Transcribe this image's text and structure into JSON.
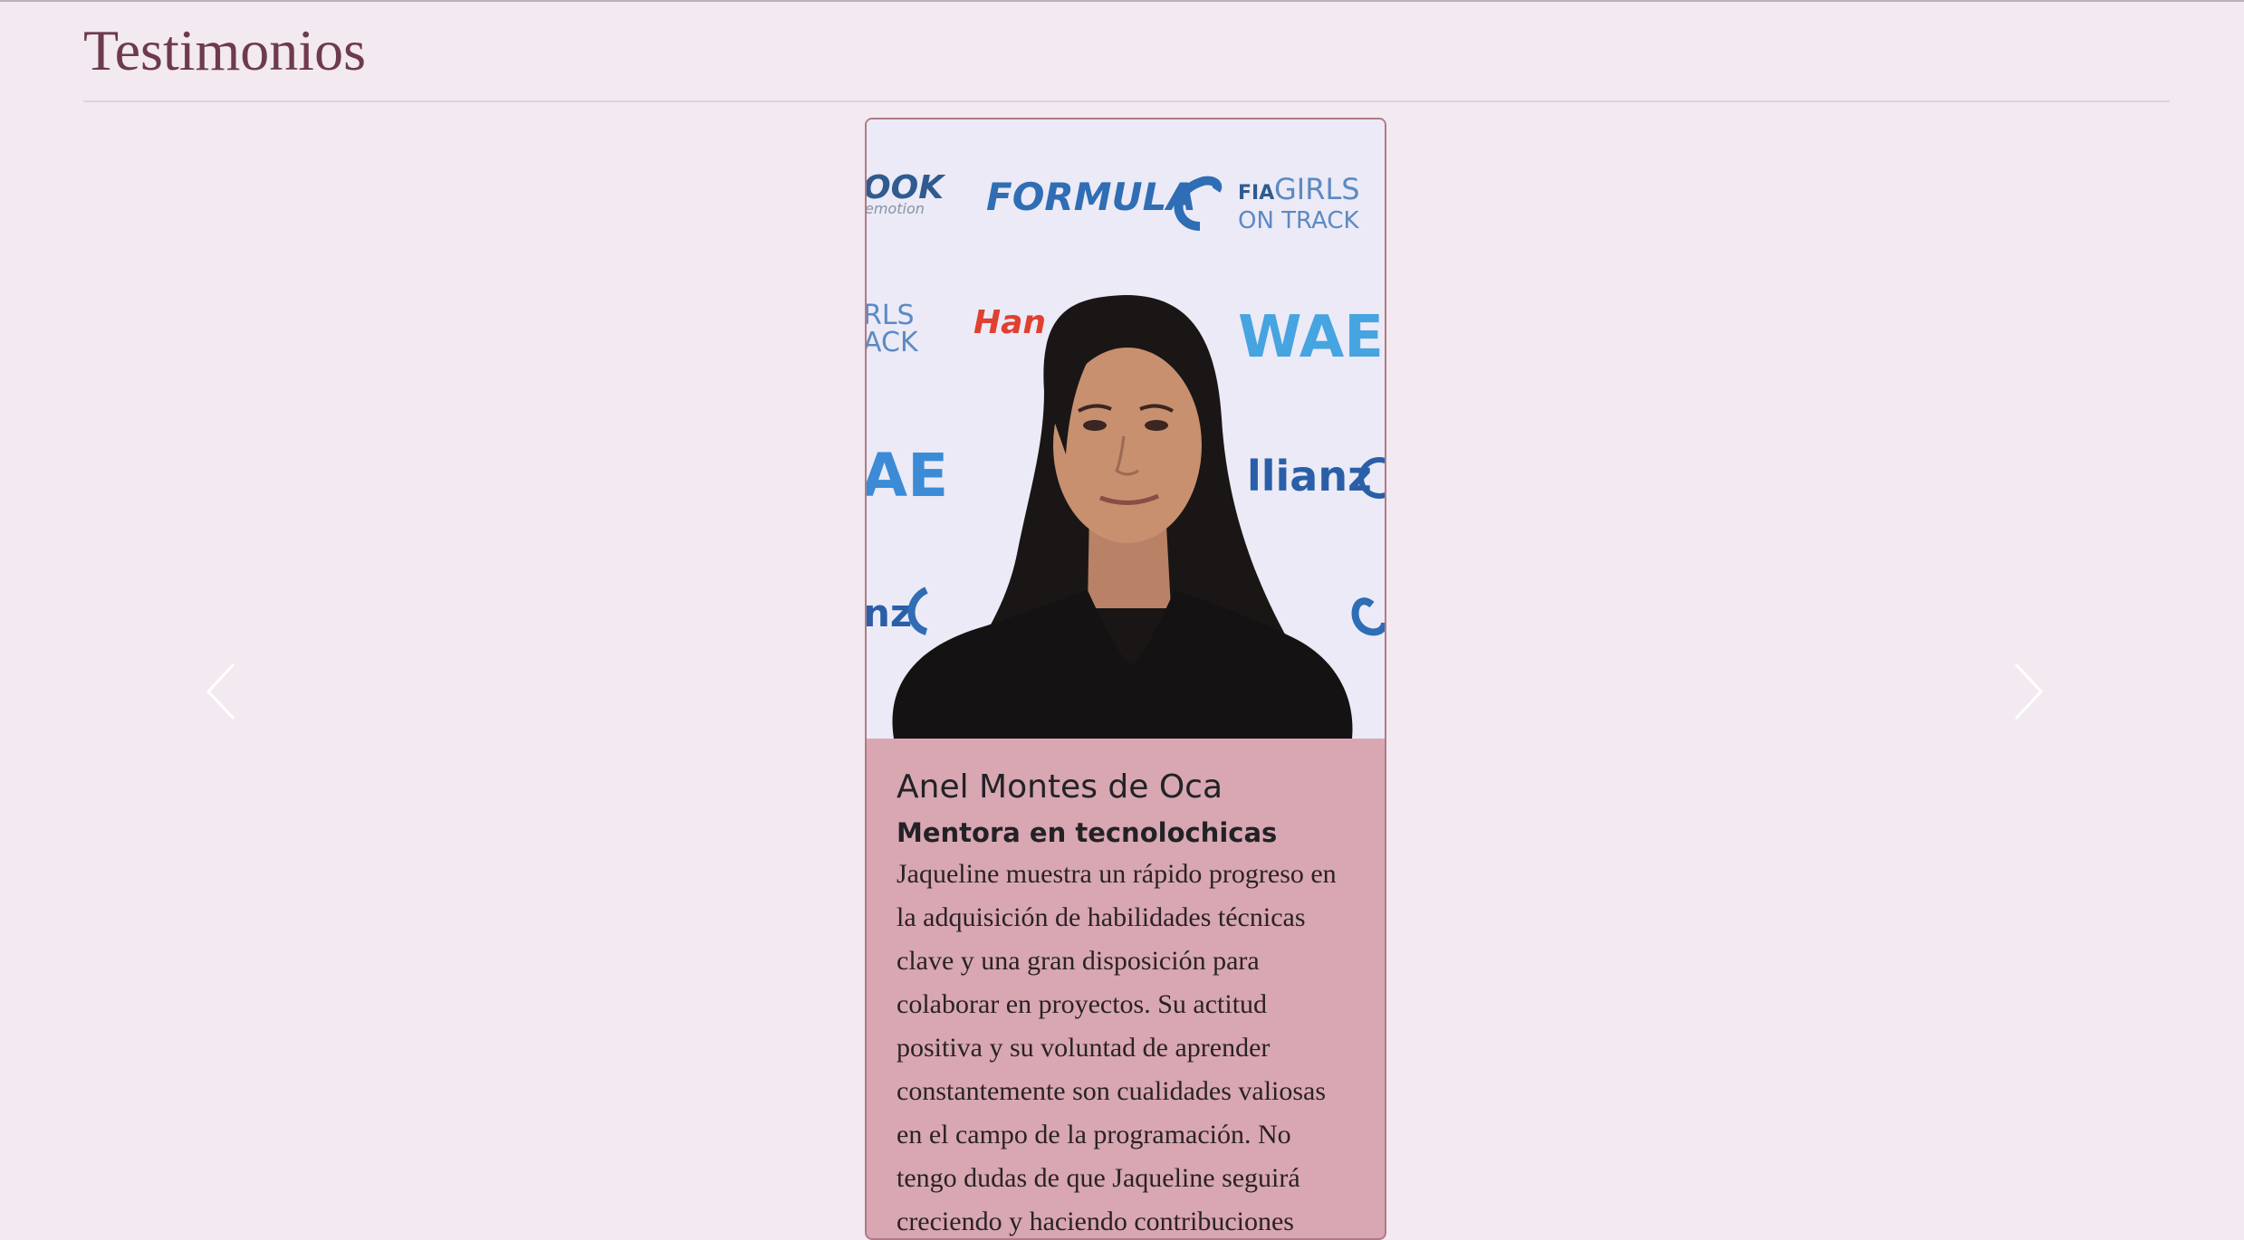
{
  "section": {
    "title": "Testimonios"
  },
  "carousel": {
    "prev_icon": "chevron-left-icon",
    "next_icon": "chevron-right-icon"
  },
  "testimonial": {
    "name": "Anel Montes de Oca",
    "role": "Mentora en tecnolochicas",
    "quote": "Jaqueline muestra un rápido progreso en la adquisición de habilidades técnicas clave y una gran disposición para colaborar en proyectos. Su actitud positiva y su voluntad de aprender constantemente son cualidades valiosas en el campo de la programación. No tengo dudas de que Jaqueline seguirá creciendo y haciendo contribuciones",
    "photo_backdrop_logos": [
      "OOK",
      "emotion",
      "FORMULA",
      "FIA",
      "GIRLS",
      "ON TRACK",
      "RLS",
      "ACK",
      "Han",
      "WAE",
      "AE",
      "llianz",
      "nz"
    ]
  },
  "colors": {
    "background": "#f2eaf0",
    "title": "#6e3a4c",
    "card": "#d8a7b1",
    "card_border": "#b07a86",
    "logo_blue": "#3f7fc6",
    "logo_red": "#e0402f"
  }
}
